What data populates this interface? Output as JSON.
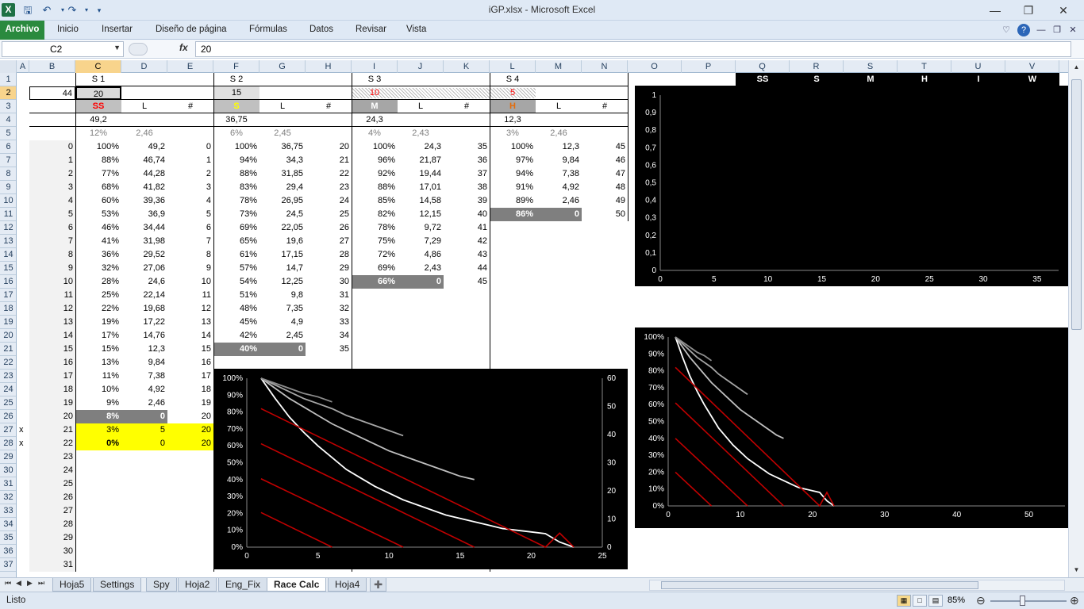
{
  "window": {
    "title": "iGP.xlsx  -  Microsoft Excel",
    "app_icon": "X"
  },
  "ribbon_tabs": [
    "Archivo",
    "Inicio",
    "Insertar",
    "Diseño de página",
    "Fórmulas",
    "Datos",
    "Revisar",
    "Vista"
  ],
  "formula_bar": {
    "name_box": "C2",
    "fx": "fx",
    "value": "20"
  },
  "columns": [
    "A",
    "B",
    "C",
    "D",
    "E",
    "F",
    "G",
    "H",
    "I",
    "J",
    "K",
    "L",
    "M",
    "N",
    "O",
    "P",
    "Q",
    "R",
    "S",
    "T",
    "U",
    "V"
  ],
  "rows": [
    "1",
    "2",
    "3",
    "4",
    "5",
    "6",
    "7",
    "8",
    "9",
    "10",
    "11",
    "12",
    "13",
    "14",
    "15",
    "16",
    "17",
    "18",
    "19",
    "20",
    "21",
    "22",
    "23",
    "24",
    "25",
    "26",
    "27",
    "28",
    "29",
    "30",
    "31",
    "32",
    "33",
    "34",
    "35",
    "36",
    "37"
  ],
  "stints": [
    {
      "header": "S 1",
      "input": "20",
      "compound": "SS",
      "start": "49,2",
      "pct": "12%",
      "per_lap": "2,46",
      "rows": [
        [
          "100%",
          "49,2",
          "0"
        ],
        [
          "88%",
          "46,74",
          "1"
        ],
        [
          "77%",
          "44,28",
          "2"
        ],
        [
          "68%",
          "41,82",
          "3"
        ],
        [
          "60%",
          "39,36",
          "4"
        ],
        [
          "53%",
          "36,9",
          "5"
        ],
        [
          "46%",
          "34,44",
          "6"
        ],
        [
          "41%",
          "31,98",
          "7"
        ],
        [
          "36%",
          "29,52",
          "8"
        ],
        [
          "32%",
          "27,06",
          "9"
        ],
        [
          "28%",
          "24,6",
          "10"
        ],
        [
          "25%",
          "22,14",
          "11"
        ],
        [
          "22%",
          "19,68",
          "12"
        ],
        [
          "19%",
          "17,22",
          "13"
        ],
        [
          "17%",
          "14,76",
          "14"
        ],
        [
          "15%",
          "12,3",
          "15"
        ],
        [
          "13%",
          "9,84",
          "16"
        ],
        [
          "11%",
          "7,38",
          "17"
        ],
        [
          "10%",
          "4,92",
          "18"
        ],
        [
          "9%",
          "2,46",
          "19"
        ],
        [
          "8%",
          "0",
          "20"
        ],
        [
          "3%",
          "5",
          "20"
        ],
        [
          "0%",
          "0",
          "20"
        ]
      ]
    },
    {
      "header": "S 2",
      "input": "15",
      "compound": "S",
      "start": "36,75",
      "pct": "6%",
      "per_lap": "2,45",
      "rows": [
        [
          "100%",
          "36,75",
          "20"
        ],
        [
          "94%",
          "34,3",
          "21"
        ],
        [
          "88%",
          "31,85",
          "22"
        ],
        [
          "83%",
          "29,4",
          "23"
        ],
        [
          "78%",
          "26,95",
          "24"
        ],
        [
          "73%",
          "24,5",
          "25"
        ],
        [
          "69%",
          "22,05",
          "26"
        ],
        [
          "65%",
          "19,6",
          "27"
        ],
        [
          "61%",
          "17,15",
          "28"
        ],
        [
          "57%",
          "14,7",
          "29"
        ],
        [
          "54%",
          "12,25",
          "30"
        ],
        [
          "51%",
          "9,8",
          "31"
        ],
        [
          "48%",
          "7,35",
          "32"
        ],
        [
          "45%",
          "4,9",
          "33"
        ],
        [
          "42%",
          "2,45",
          "34"
        ],
        [
          "40%",
          "0",
          "35"
        ]
      ]
    },
    {
      "header": "S 3",
      "input": "10",
      "compound": "M",
      "start": "24,3",
      "pct": "4%",
      "per_lap": "2,43",
      "rows": [
        [
          "100%",
          "24,3",
          "35"
        ],
        [
          "96%",
          "21,87",
          "36"
        ],
        [
          "92%",
          "19,44",
          "37"
        ],
        [
          "88%",
          "17,01",
          "38"
        ],
        [
          "85%",
          "14,58",
          "39"
        ],
        [
          "82%",
          "12,15",
          "40"
        ],
        [
          "78%",
          "9,72",
          "41"
        ],
        [
          "75%",
          "7,29",
          "42"
        ],
        [
          "72%",
          "4,86",
          "43"
        ],
        [
          "69%",
          "2,43",
          "44"
        ],
        [
          "66%",
          "0",
          "45"
        ]
      ]
    },
    {
      "header": "S 4",
      "input": "5",
      "compound": "H",
      "start": "12,3",
      "pct": "3%",
      "per_lap": "2,46",
      "rows": [
        [
          "100%",
          "12,3",
          "45"
        ],
        [
          "97%",
          "9,84",
          "46"
        ],
        [
          "94%",
          "7,38",
          "47"
        ],
        [
          "91%",
          "4,92",
          "48"
        ],
        [
          "89%",
          "2,46",
          "49"
        ],
        [
          "86%",
          "0",
          "50"
        ]
      ]
    }
  ],
  "header_L": "L",
  "header_hash": "#",
  "B2": "44",
  "B_laps": [
    "0",
    "1",
    "2",
    "3",
    "4",
    "5",
    "6",
    "7",
    "8",
    "9",
    "10",
    "11",
    "12",
    "13",
    "14",
    "15",
    "16",
    "17",
    "18",
    "19",
    "20",
    "21",
    "22",
    "23",
    "24",
    "25",
    "26",
    "27",
    "28",
    "29",
    "30",
    "31"
  ],
  "A_marks": {
    "27": "x",
    "28": "x"
  },
  "compound_legend": [
    "SS",
    "S",
    "M",
    "H",
    "I",
    "W"
  ],
  "colors": {
    "black": "#000000",
    "yellow": "#ffff00",
    "grey_cell": "#7f7f7f",
    "light_grey": "#c0c0c0",
    "red_text": "#ff0000",
    "orange_text": "#e46c0a",
    "light_yellow": "#ffff66"
  },
  "chart_data": [
    {
      "type": "line",
      "id": "top-right",
      "ylim": [
        0,
        1
      ],
      "xlim": [
        0,
        37
      ],
      "yticks": [
        "0",
        "0,1",
        "0,2",
        "0,3",
        "0,4",
        "0,5",
        "0,6",
        "0,7",
        "0,8",
        "0,9",
        "1"
      ],
      "xticks": [
        "0",
        "5",
        "10",
        "15",
        "20",
        "25",
        "30",
        "35"
      ],
      "series": []
    },
    {
      "type": "line",
      "id": "bottom-left",
      "xlim": [
        0,
        25
      ],
      "ylim": [
        0,
        1
      ],
      "y2lim": [
        0,
        60
      ],
      "yticks": [
        "0%",
        "10%",
        "20%",
        "30%",
        "40%",
        "50%",
        "60%",
        "70%",
        "80%",
        "90%",
        "100%"
      ],
      "y2ticks": [
        "0",
        "10",
        "20",
        "30",
        "40",
        "50",
        "60"
      ],
      "xticks": [
        "0",
        "5",
        "10",
        "15",
        "20",
        "25"
      ],
      "series": [
        {
          "color": "#ffffff",
          "x": [
            1,
            2,
            3,
            4,
            5,
            6,
            7,
            8,
            9,
            10,
            11,
            12,
            13,
            14,
            15,
            16,
            17,
            18,
            19,
            20,
            21,
            22,
            23
          ],
          "y": [
            1.0,
            0.88,
            0.77,
            0.68,
            0.6,
            0.53,
            0.46,
            0.41,
            0.36,
            0.32,
            0.28,
            0.25,
            0.22,
            0.19,
            0.17,
            0.15,
            0.13,
            0.11,
            0.1,
            0.09,
            0.08,
            0.03,
            0.0
          ]
        },
        {
          "color": "#bfbfbf",
          "x": [
            1,
            2,
            3,
            4,
            5,
            6,
            7,
            8,
            9,
            10,
            11,
            12,
            13,
            14,
            15,
            16
          ],
          "y": [
            1.0,
            0.94,
            0.88,
            0.83,
            0.78,
            0.73,
            0.69,
            0.65,
            0.61,
            0.57,
            0.54,
            0.51,
            0.48,
            0.45,
            0.42,
            0.4
          ]
        },
        {
          "color": "#a6a6a6",
          "x": [
            1,
            2,
            3,
            4,
            5,
            6,
            7,
            8,
            9,
            10,
            11
          ],
          "y": [
            1.0,
            0.96,
            0.92,
            0.88,
            0.85,
            0.82,
            0.78,
            0.75,
            0.72,
            0.69,
            0.66
          ]
        },
        {
          "color": "#8c8c8c",
          "x": [
            1,
            2,
            3,
            4,
            5,
            6
          ],
          "y": [
            1.0,
            0.97,
            0.94,
            0.91,
            0.89,
            0.86
          ]
        },
        {
          "color": "#c00000",
          "axis": "y2",
          "x": [
            1,
            21,
            22,
            23
          ],
          "y": [
            49.2,
            0,
            5,
            0
          ]
        },
        {
          "color": "#c00000",
          "axis": "y2",
          "x": [
            1,
            16
          ],
          "y": [
            36.75,
            0
          ]
        },
        {
          "color": "#c00000",
          "axis": "y2",
          "x": [
            1,
            11
          ],
          "y": [
            24.3,
            0
          ]
        },
        {
          "color": "#c00000",
          "axis": "y2",
          "x": [
            1,
            6
          ],
          "y": [
            12.3,
            0
          ]
        }
      ]
    },
    {
      "type": "line",
      "id": "bottom-right",
      "xlim": [
        0,
        55
      ],
      "ylim": [
        0,
        1
      ],
      "yticks": [
        "0%",
        "10%",
        "20%",
        "30%",
        "40%",
        "50%",
        "60%",
        "70%",
        "80%",
        "90%",
        "100%"
      ],
      "xticks": [
        "0",
        "10",
        "20",
        "30",
        "40",
        "50"
      ],
      "series": [
        {
          "color": "#ffffff",
          "x": [
            1,
            2,
            3,
            4,
            5,
            6,
            7,
            8,
            9,
            10,
            11,
            12,
            13,
            14,
            15,
            16,
            17,
            18,
            19,
            20,
            21,
            22,
            23
          ],
          "y": [
            1.0,
            0.88,
            0.77,
            0.68,
            0.6,
            0.53,
            0.46,
            0.41,
            0.36,
            0.32,
            0.28,
            0.25,
            0.22,
            0.19,
            0.17,
            0.15,
            0.13,
            0.11,
            0.1,
            0.09,
            0.08,
            0.03,
            0.0
          ]
        },
        {
          "color": "#bfbfbf",
          "x": [
            1,
            2,
            3,
            4,
            5,
            6,
            7,
            8,
            9,
            10,
            11,
            12,
            13,
            14,
            15,
            16
          ],
          "y": [
            1.0,
            0.94,
            0.88,
            0.83,
            0.78,
            0.73,
            0.69,
            0.65,
            0.61,
            0.57,
            0.54,
            0.51,
            0.48,
            0.45,
            0.42,
            0.4
          ]
        },
        {
          "color": "#a6a6a6",
          "x": [
            1,
            2,
            3,
            4,
            5,
            6,
            7,
            8,
            9,
            10,
            11
          ],
          "y": [
            1.0,
            0.96,
            0.92,
            0.88,
            0.85,
            0.82,
            0.78,
            0.75,
            0.72,
            0.69,
            0.66
          ]
        },
        {
          "color": "#8c8c8c",
          "x": [
            1,
            2,
            3,
            4,
            5,
            6
          ],
          "y": [
            1.0,
            0.97,
            0.94,
            0.91,
            0.89,
            0.86
          ]
        },
        {
          "color": "#c00000",
          "x": [
            1,
            21,
            22,
            23
          ],
          "y": [
            0.82,
            0,
            0.08,
            0
          ]
        },
        {
          "color": "#c00000",
          "x": [
            1,
            16
          ],
          "y": [
            0.61,
            0
          ]
        },
        {
          "color": "#c00000",
          "x": [
            1,
            11
          ],
          "y": [
            0.4,
            0
          ]
        },
        {
          "color": "#c00000",
          "x": [
            1,
            6
          ],
          "y": [
            0.2,
            0
          ]
        }
      ]
    }
  ],
  "sheet_tabs": [
    "Hoja5",
    "Settings",
    "Spy",
    "Hoja2",
    "Eng_Fix",
    "Race Calc",
    "Hoja4"
  ],
  "active_sheet": "Race Calc",
  "status": {
    "ready": "Listo",
    "zoom": "85%"
  }
}
